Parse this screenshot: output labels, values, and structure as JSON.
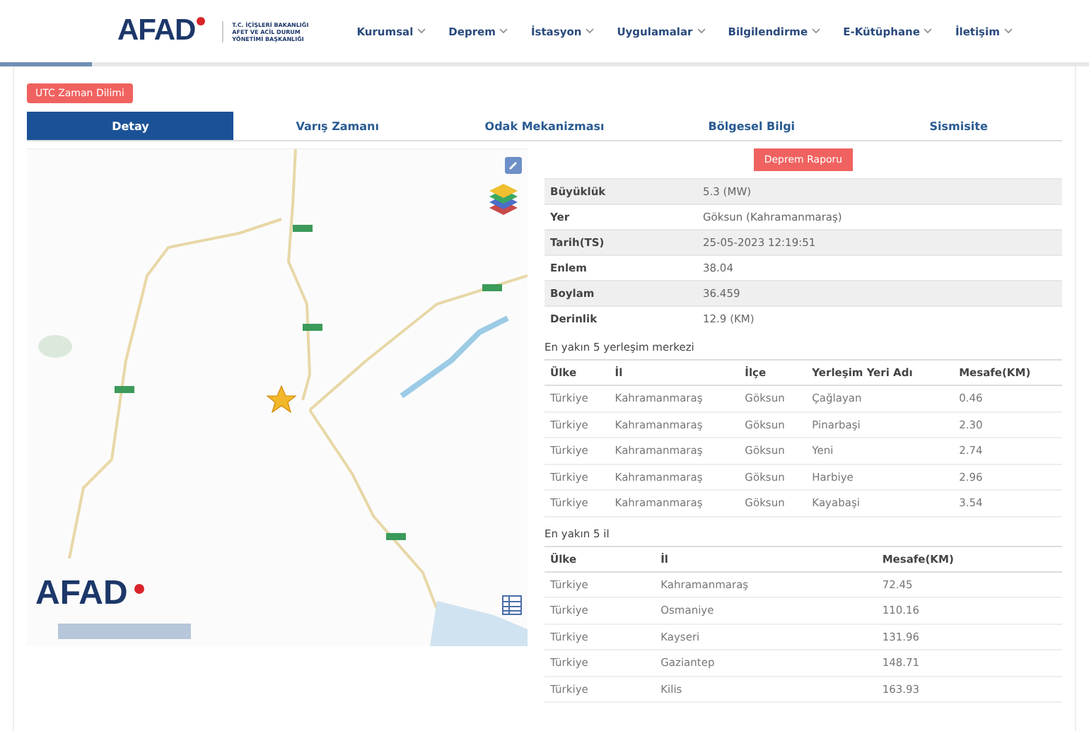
{
  "header": {
    "logo": "AFAD",
    "logo_subtitle": [
      "T.C. İÇİŞLERİ BAKANLIĞI",
      "AFET VE ACİL DURUM",
      "YÖNETİMİ BAŞKANLIĞI"
    ],
    "menu": [
      {
        "label": "Kurumsal"
      },
      {
        "label": "Deprem"
      },
      {
        "label": "İstasyon"
      },
      {
        "label": "Uygulamalar"
      },
      {
        "label": "Bilgilendirme"
      },
      {
        "label": "E-Kütüphane"
      },
      {
        "label": "İletişim"
      }
    ]
  },
  "utc_button": "UTC Zaman Dilimi",
  "tabs": [
    {
      "label": "Detay",
      "selected": true
    },
    {
      "label": "Varış Zamanı",
      "selected": false
    },
    {
      "label": "Odak Mekanizması",
      "selected": false
    },
    {
      "label": "Bölgesel Bilgi",
      "selected": false
    },
    {
      "label": "Sismisite",
      "selected": false
    }
  ],
  "map": {
    "logo": "AFAD"
  },
  "report_button": "Deprem Raporu",
  "details": [
    {
      "label": "Büyüklük",
      "value": "5.3 (MW)"
    },
    {
      "label": "Yer",
      "value": "Göksun (Kahramanmaraş)"
    },
    {
      "label": "Tarih(TS)",
      "value": "25-05-2023 12:19:51"
    },
    {
      "label": "Enlem",
      "value": "38.04"
    },
    {
      "label": "Boylam",
      "value": "36.459"
    },
    {
      "label": "Derinlik",
      "value": "12.9 (KM)"
    }
  ],
  "settlements": {
    "title": "En yakın 5 yerleşim merkezi",
    "columns": [
      "Ülke",
      "İl",
      "İlçe",
      "Yerleşim Yeri Adı",
      "Mesafe(KM)"
    ],
    "rows": [
      [
        "Türkiye",
        "Kahramanmaraş",
        "Göksun",
        "Çağlayan",
        "0.46"
      ],
      [
        "Türkiye",
        "Kahramanmaraş",
        "Göksun",
        "Pinarbaşi",
        "2.30"
      ],
      [
        "Türkiye",
        "Kahramanmaraş",
        "Göksun",
        "Yeni",
        "2.74"
      ],
      [
        "Türkiye",
        "Kahramanmaraş",
        "Göksun",
        "Harbiye",
        "2.96"
      ],
      [
        "Türkiye",
        "Kahramanmaraş",
        "Göksun",
        "Kayabaşi",
        "3.54"
      ]
    ]
  },
  "provinces": {
    "title": "En yakın 5 il",
    "columns": [
      "Ülke",
      "İl",
      "Mesafe(KM)"
    ],
    "rows": [
      [
        "Türkiye",
        "Kahramanmaraş",
        "72.45"
      ],
      [
        "Türkiye",
        "Osmaniye",
        "110.16"
      ],
      [
        "Türkiye",
        "Kayseri",
        "131.96"
      ],
      [
        "Türkiye",
        "Gaziantep",
        "148.71"
      ],
      [
        "Türkiye",
        "Kilis",
        "163.93"
      ]
    ]
  }
}
